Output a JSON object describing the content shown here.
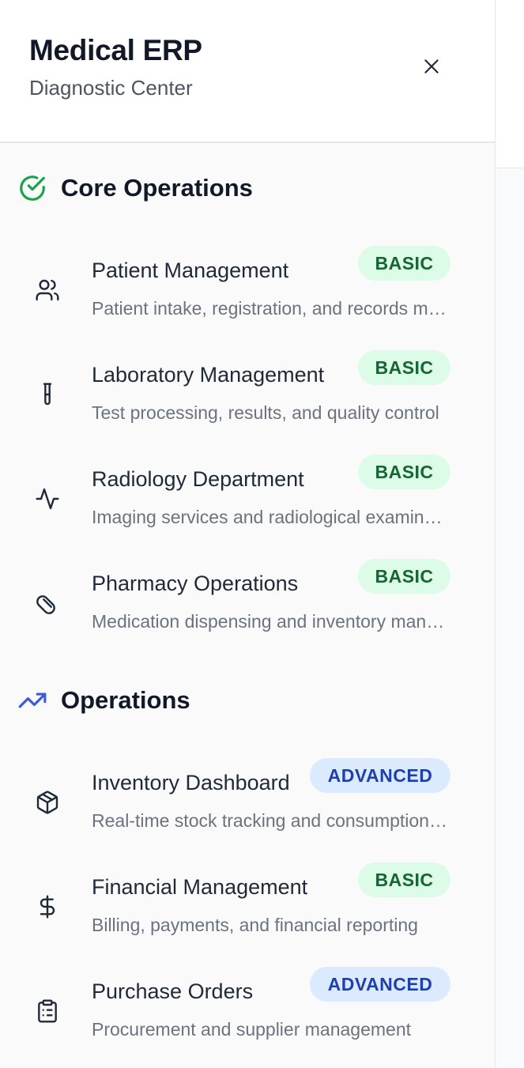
{
  "header": {
    "title": "Medical ERP",
    "subtitle": "Diagnostic Center",
    "close_icon": "close-icon"
  },
  "sections": [
    {
      "title": "Core Operations",
      "icon": "check-circle-icon",
      "icon_color": "#16a34a",
      "items": [
        {
          "label": "Patient Management",
          "description": "Patient intake, registration, and records management",
          "badge": "BASIC",
          "icon": "users-icon"
        },
        {
          "label": "Laboratory Management",
          "description": "Test processing, results, and quality control",
          "badge": "BASIC",
          "icon": "test-tube-icon"
        },
        {
          "label": "Radiology Department",
          "description": "Imaging services and radiological examinations",
          "badge": "BASIC",
          "icon": "activity-icon"
        },
        {
          "label": "Pharmacy Operations",
          "description": "Medication dispensing and inventory management",
          "badge": "BASIC",
          "icon": "pill-icon"
        }
      ]
    },
    {
      "title": "Operations",
      "icon": "trending-up-icon",
      "icon_color": "#3b5bdb",
      "items": [
        {
          "label": "Inventory Dashboard",
          "description": "Real-time stock tracking and consumption analytics",
          "badge": "ADVANCED",
          "icon": "package-icon"
        },
        {
          "label": "Financial Management",
          "description": "Billing, payments, and financial reporting",
          "badge": "BASIC",
          "icon": "dollar-icon"
        },
        {
          "label": "Purchase Orders",
          "description": "Procurement and supplier management",
          "badge": "ADVANCED",
          "icon": "clipboard-icon"
        }
      ]
    }
  ],
  "colors": {
    "basic_badge_bg": "#dcfce7",
    "basic_badge_text": "#166534",
    "advanced_badge_bg": "#dbeafe",
    "advanced_badge_text": "#1e40af"
  }
}
